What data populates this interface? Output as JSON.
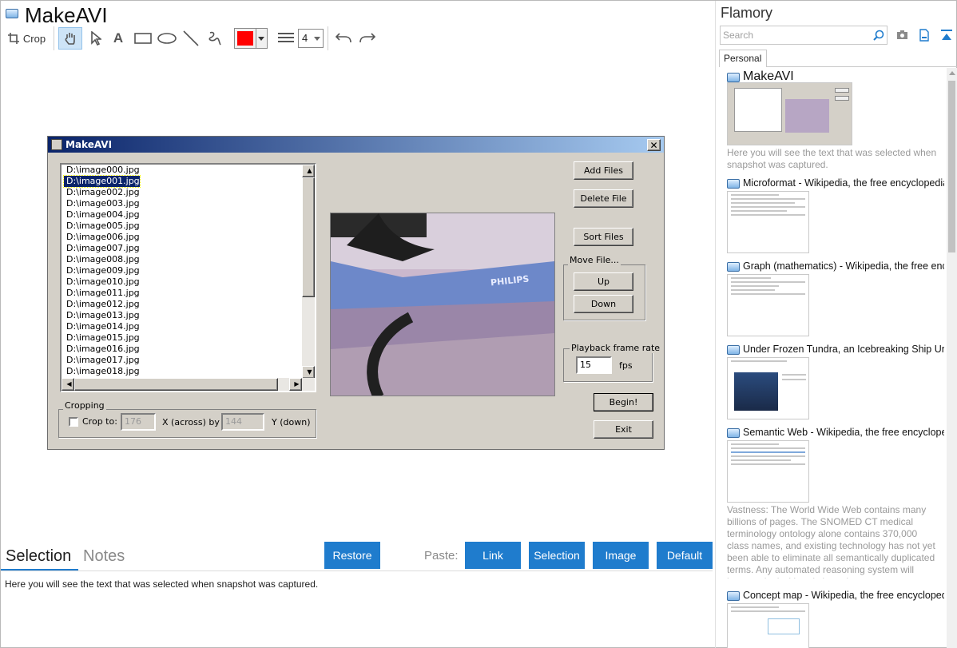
{
  "document": {
    "title": "MakeAVI"
  },
  "toolbar": {
    "crop_label": "Crop",
    "line_width_value": "4",
    "color_swatch": "#ff0000"
  },
  "snapshot_window": {
    "title": "MakeAVI",
    "files": [
      "D:\\image000.jpg",
      "D:\\image001.jpg",
      "D:\\image002.jpg",
      "D:\\image003.jpg",
      "D:\\image004.jpg",
      "D:\\image005.jpg",
      "D:\\image006.jpg",
      "D:\\image007.jpg",
      "D:\\image008.jpg",
      "D:\\image009.jpg",
      "D:\\image010.jpg",
      "D:\\image011.jpg",
      "D:\\image012.jpg",
      "D:\\image013.jpg",
      "D:\\image014.jpg",
      "D:\\image015.jpg",
      "D:\\image016.jpg",
      "D:\\image017.jpg",
      "D:\\image018.jpg"
    ],
    "selected_file_index": 1,
    "buttons": {
      "add_files": "Add Files",
      "delete_file": "Delete File",
      "sort_files": "Sort Files",
      "up": "Up",
      "down": "Down",
      "begin": "Begin!",
      "exit": "Exit"
    },
    "move_group_label": "Move File...",
    "cropping": {
      "group_label": "Cropping",
      "checkbox_label": "Crop to:",
      "width_value": "176",
      "across_label": "X (across) by",
      "height_value": "144",
      "down_label": "Y (down)"
    },
    "playback": {
      "group_label": "Playback frame rate",
      "value": "15",
      "unit": "fps"
    },
    "preview_text": "PHILIPS"
  },
  "bottom": {
    "tabs": [
      "Selection",
      "Notes"
    ],
    "restore_label": "Restore",
    "paste_label": "Paste:",
    "paste_buttons": [
      "Link",
      "Selection",
      "Image",
      "Default"
    ],
    "selection_text": "Here you will see the text that was selected when snapshot was captured."
  },
  "right_panel": {
    "app_name": "Flamory",
    "search_placeholder": "Search",
    "tab_label": "Personal",
    "snapshots": [
      {
        "title": "MakeAVI",
        "desc": "Here you will see the text that was selected when snapshot was captured."
      },
      {
        "title": "Microformat - Wikipedia, the free encyclopedia",
        "desc": ""
      },
      {
        "title": "Graph (mathematics) - Wikipedia, the free ency",
        "desc": ""
      },
      {
        "title": "Under Frozen Tundra, an Icebreaking Ship Unco",
        "desc": ""
      },
      {
        "title": "Semantic Web - Wikipedia, the free encycloped",
        "desc": "Vastness: The World Wide Web contains many billions of pages. The SNOMED CT medical terminology ontology alone contains 370,000 class names, and existing technology has not yet been able to eliminate all semantically duplicated terms. Any automated reasoning system will have to deal with truly huge inputs."
      },
      {
        "title": "Concept map - Wikipedia, the free encyclopedi",
        "desc": ""
      }
    ]
  },
  "colors": {
    "accent": "#1f7ccd",
    "win_face": "#d4d0c8",
    "title_bar": "#0a246a"
  }
}
